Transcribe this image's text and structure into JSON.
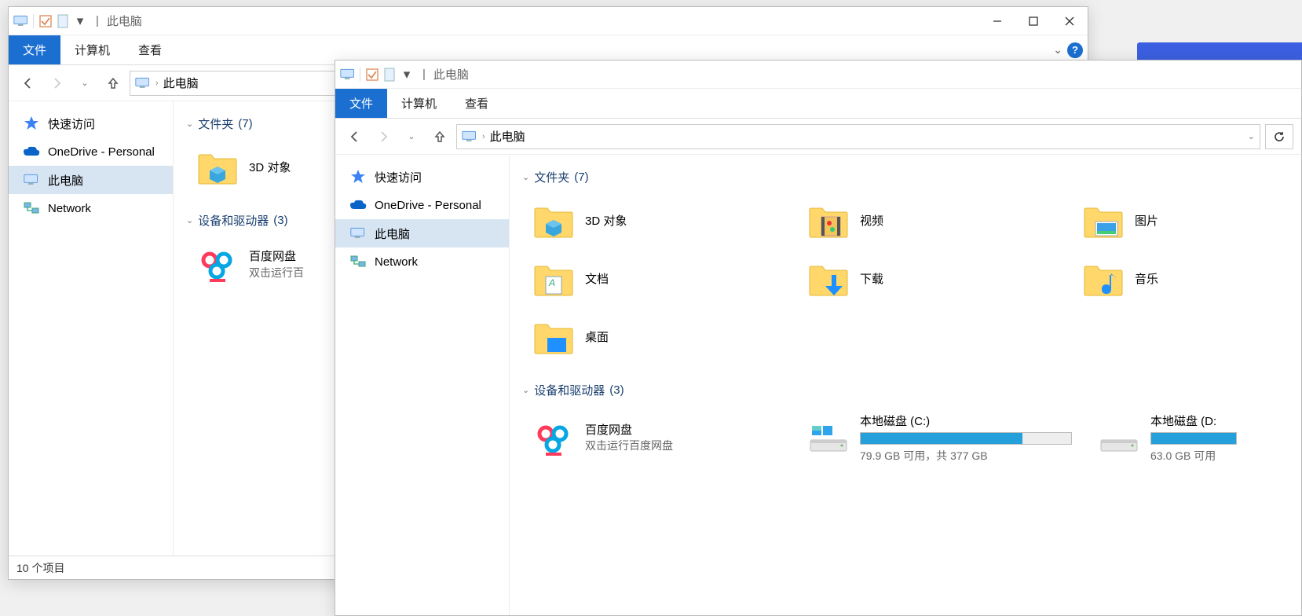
{
  "titles": {
    "pc": "此电脑",
    "sep": "|"
  },
  "ribbon": {
    "file": "文件",
    "computer": "计算机",
    "view": "查看"
  },
  "sidebar": {
    "quick": "快速访问",
    "onedrive": "OneDrive - Personal",
    "this_pc": "此电脑",
    "network": "Network"
  },
  "breadcrumb": {
    "root": "此电脑",
    "sep": "›"
  },
  "groups": {
    "folders_label": "文件夹",
    "folders_count": "(7)",
    "devices_label": "设备和驱动器",
    "devices_count": "(3)"
  },
  "folders": {
    "objects3d": "3D 对象",
    "videos": "视频",
    "pictures": "图片",
    "documents": "文档",
    "downloads": "下载",
    "music": "音乐",
    "desktop": "桌面"
  },
  "baidu": {
    "name": "百度网盘",
    "sub": "双击运行百度网盘",
    "sub_trunc": "双击运行百"
  },
  "drives": {
    "c": {
      "name": "本地磁盘 (C:)",
      "status": "79.9 GB 可用，共 377 GB",
      "fill_pct": 77
    },
    "d": {
      "name": "本地磁盘 (D:",
      "status": "63.0 GB 可用",
      "fill_pct": 100
    }
  },
  "status": {
    "items": "10 个项目"
  }
}
